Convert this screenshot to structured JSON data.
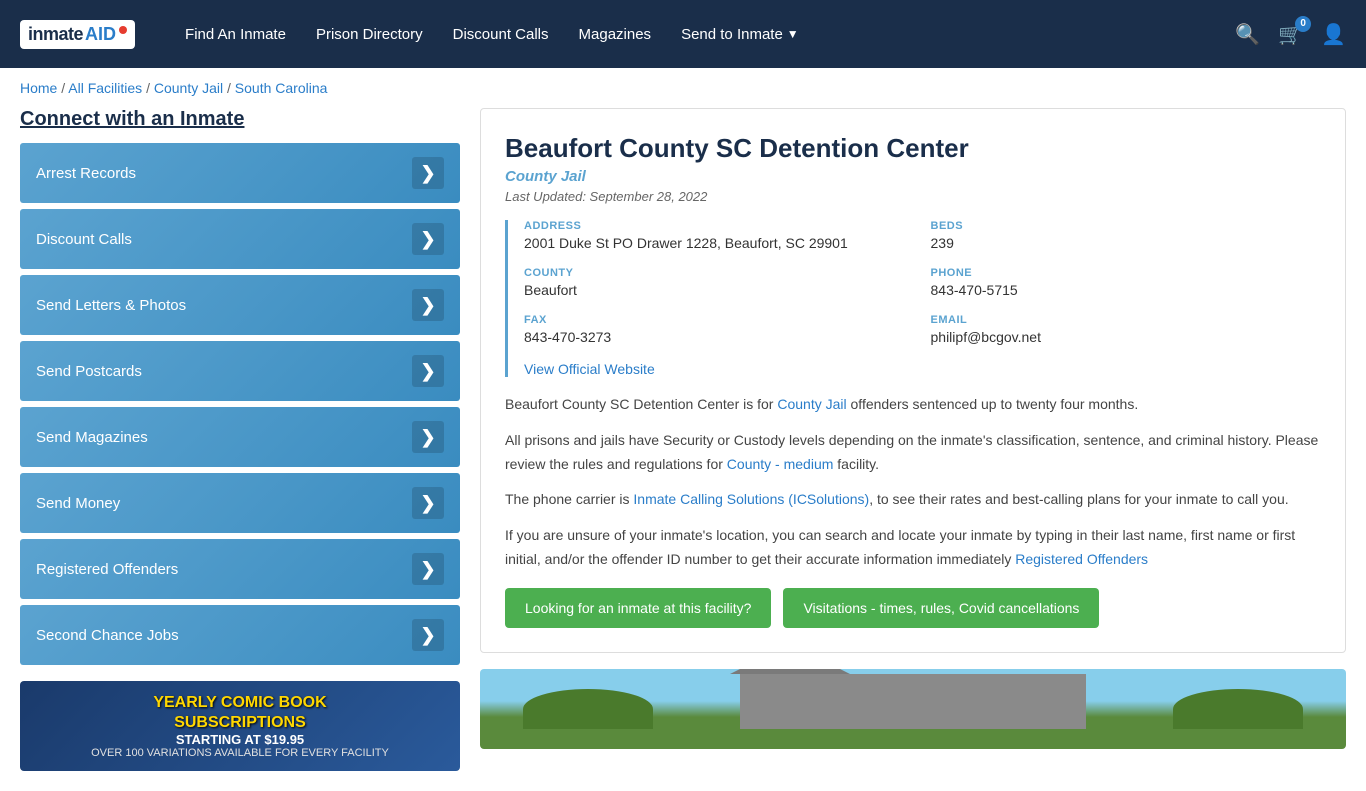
{
  "header": {
    "logo": "InmateAID",
    "nav": [
      {
        "label": "Find An Inmate",
        "id": "find-inmate"
      },
      {
        "label": "Prison Directory",
        "id": "prison-directory"
      },
      {
        "label": "Discount Calls",
        "id": "discount-calls"
      },
      {
        "label": "Magazines",
        "id": "magazines"
      },
      {
        "label": "Send to Inmate",
        "id": "send-to-inmate",
        "dropdown": true
      }
    ],
    "cart_count": "0"
  },
  "breadcrumb": {
    "items": [
      "Home",
      "All Facilities",
      "County Jail",
      "South Carolina"
    ],
    "separator": "/"
  },
  "sidebar": {
    "title": "Connect with an Inmate",
    "buttons": [
      {
        "label": "Arrest Records",
        "id": "arrest-records"
      },
      {
        "label": "Discount Calls",
        "id": "discount-calls"
      },
      {
        "label": "Send Letters & Photos",
        "id": "send-letters"
      },
      {
        "label": "Send Postcards",
        "id": "send-postcards"
      },
      {
        "label": "Send Magazines",
        "id": "send-magazines"
      },
      {
        "label": "Send Money",
        "id": "send-money"
      },
      {
        "label": "Registered Offenders",
        "id": "registered-offenders"
      },
      {
        "label": "Second Chance Jobs",
        "id": "second-chance-jobs"
      }
    ],
    "ad": {
      "title": "YEARLY COMIC BOOK\nSUBSCRIPTIONS",
      "price": "STARTING AT $19.95",
      "subtitle": "OVER 100 VARIATIONS AVAILABLE FOR EVERY FACILITY"
    }
  },
  "facility": {
    "name": "Beaufort County SC Detention Center",
    "type": "County Jail",
    "last_updated": "Last Updated: September 28, 2022",
    "address_label": "ADDRESS",
    "address": "2001 Duke St PO Drawer 1228, Beaufort, SC 29901",
    "beds_label": "BEDS",
    "beds": "239",
    "county_label": "COUNTY",
    "county": "Beaufort",
    "phone_label": "PHONE",
    "phone": "843-470-5715",
    "fax_label": "FAX",
    "fax": "843-470-3273",
    "email_label": "EMAIL",
    "email": "philipf@bcgov.net",
    "website_label": "View Official Website",
    "description_1": "Beaufort County SC Detention Center is for ",
    "description_1_link": "County Jail",
    "description_1_end": " offenders sentenced up to twenty four months.",
    "description_2": "All prisons and jails have Security or Custody levels depending on the inmate's classification, sentence, and criminal history. Please review the rules and regulations for ",
    "description_2_link": "County - medium",
    "description_2_end": " facility.",
    "description_3": "The phone carrier is ",
    "description_3_link": "Inmate Calling Solutions (ICSolutions)",
    "description_3_end": ", to see their rates and best-calling plans for your inmate to call you.",
    "description_4": "If you are unsure of your inmate's location, you can search and locate your inmate by typing in their last name, first name or first initial, and/or the offender ID number to get their accurate information immediately ",
    "description_4_link": "Registered Offenders",
    "btn_inmate": "Looking for an inmate at this facility?",
    "btn_visitation": "Visitations - times, rules, Covid cancellations"
  }
}
